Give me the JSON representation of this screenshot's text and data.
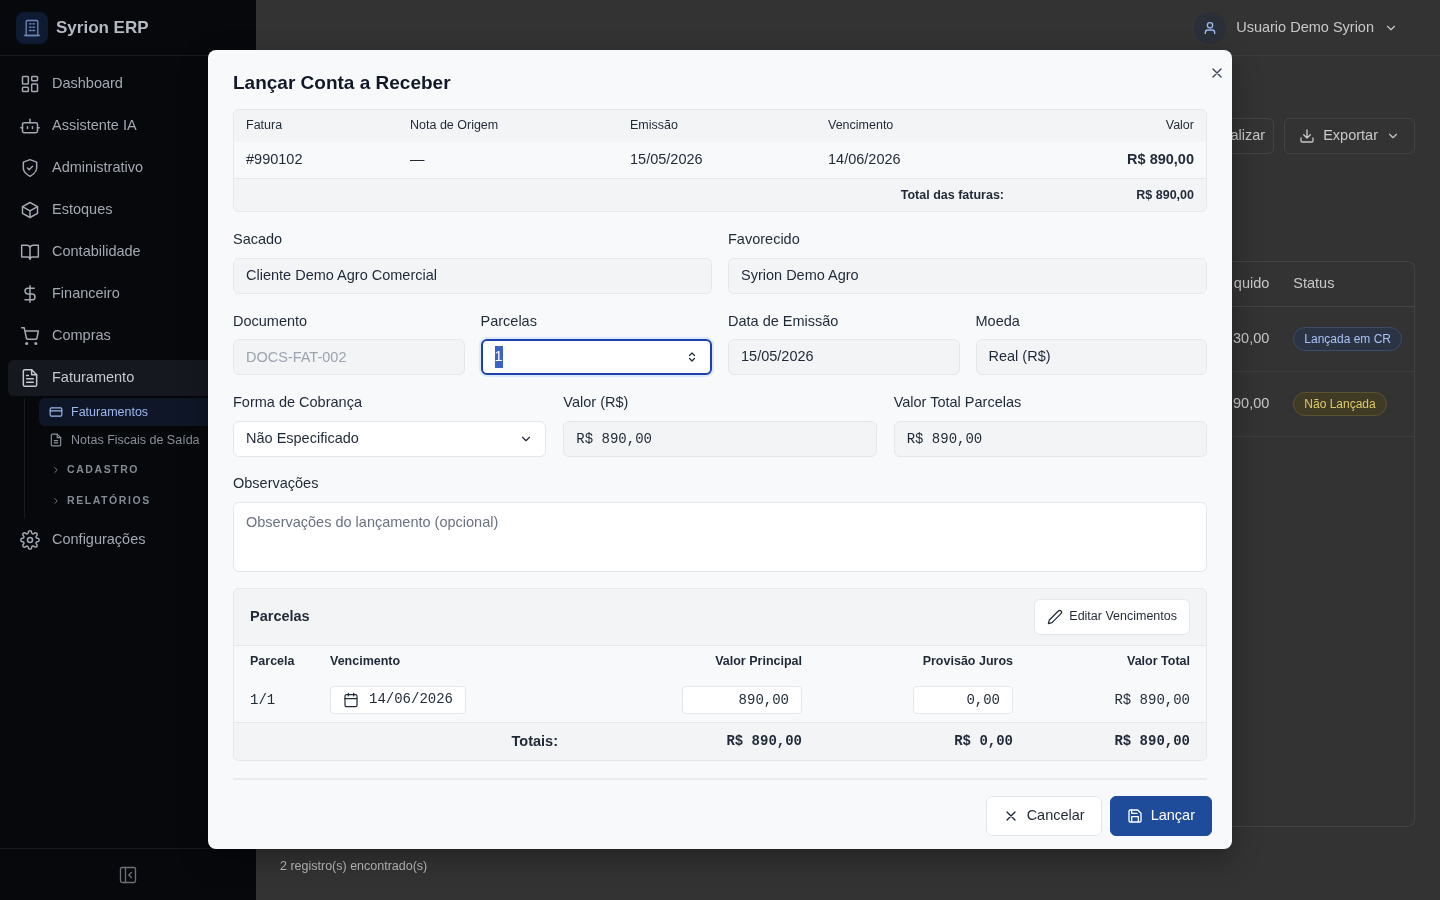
{
  "app": {
    "name": "Syrion ERP"
  },
  "sidebar": {
    "items": [
      {
        "label": "Dashboard",
        "selected": false
      },
      {
        "label": "Assistente IA",
        "selected": false
      },
      {
        "label": "Administrativo",
        "selected": false
      },
      {
        "label": "Estoques",
        "selected": false
      },
      {
        "label": "Contabilidade",
        "selected": false
      },
      {
        "label": "Financeiro",
        "selected": false
      },
      {
        "label": "Compras",
        "selected": false
      },
      {
        "label": "Faturamento",
        "selected": true,
        "children": [
          {
            "label": "Faturamentos",
            "kind": "link",
            "selected": true
          },
          {
            "label": "Notas Fiscais de Saída",
            "kind": "link",
            "selected": false
          },
          {
            "label": "CADASTRO",
            "kind": "group"
          },
          {
            "label": "RELATÓRIOS",
            "kind": "group"
          }
        ]
      },
      {
        "label": "Configurações",
        "selected": false
      }
    ]
  },
  "user": {
    "name": "Usuario Demo Syrion"
  },
  "toolbar": {
    "buttons": [
      {
        "label": "alizar",
        "kind": "plain"
      },
      {
        "label": "Exportar",
        "kind": "export"
      }
    ]
  },
  "table": {
    "columns": [
      "quido",
      "Status"
    ],
    "rows": [
      {
        "cells": [
          "30,00"
        ],
        "status": "Lançada em CR",
        "kind": "info"
      },
      {
        "cells": [
          "90,00"
        ],
        "status": "Não Lançada",
        "kind": "warning"
      }
    ]
  },
  "footer": "2 registro(s) encontrado(s)",
  "modal": {
    "title": "Lançar Conta a Receber",
    "invoices": {
      "columns": [
        "Fatura",
        "Nota de Origem",
        "Emissão",
        "Vencimento",
        "Valor"
      ],
      "rows": [
        [
          "#990102",
          "—",
          "15/05/2026",
          "14/06/2026",
          "R$ 890,00"
        ]
      ],
      "total_label": "Total das faturas:",
      "total": "R$ 890,00"
    },
    "field_rows": [
      [
        {
          "label": "Sacado",
          "kind": "readonly",
          "value": "Cliente Demo Agro Comercial"
        },
        {
          "label": "Favorecido",
          "kind": "readonly",
          "value": "Syrion Demo Agro"
        }
      ],
      [
        {
          "label": "Documento",
          "kind": "text",
          "placeholder": "DOCS-FAT-002"
        },
        {
          "label": "Parcelas",
          "kind": "number",
          "value": "1",
          "focused": true
        },
        {
          "label": "Data de Emissão",
          "kind": "readonly",
          "value": "15/05/2026"
        },
        {
          "label": "Moeda",
          "kind": "readonly",
          "value": "Real (R$)"
        }
      ],
      [
        {
          "label": "Forma de Cobrança",
          "kind": "select",
          "value": "Não Especificado"
        },
        {
          "label": "Valor (R$)",
          "kind": "money",
          "value": "R$ 890,00"
        },
        {
          "label": "Valor Total Parcelas",
          "kind": "money",
          "value": "R$ 890,00"
        }
      ]
    ],
    "notes": {
      "label": "Observações",
      "placeholder": "Observações do lançamento (opcional)"
    },
    "installments": {
      "title": "Parcelas",
      "edit_button": "Editar Vencimentos",
      "columns": [
        "Parcela",
        "Vencimento",
        "Valor Principal",
        "Provisão Juros",
        "Valor Total"
      ],
      "rows": [
        {
          "number": "1/1",
          "due": "14/06/2026",
          "principal": "890,00",
          "interest": "0,00",
          "total": "R$ 890,00"
        }
      ],
      "totals": {
        "label": "Totais:",
        "principal": "R$ 890,00",
        "interest": "R$ 0,00",
        "total": "R$ 890,00"
      }
    },
    "buttons": [
      {
        "label": "Cancelar",
        "kind": "cancel"
      },
      {
        "label": "Lançar",
        "kind": "primary"
      }
    ]
  }
}
